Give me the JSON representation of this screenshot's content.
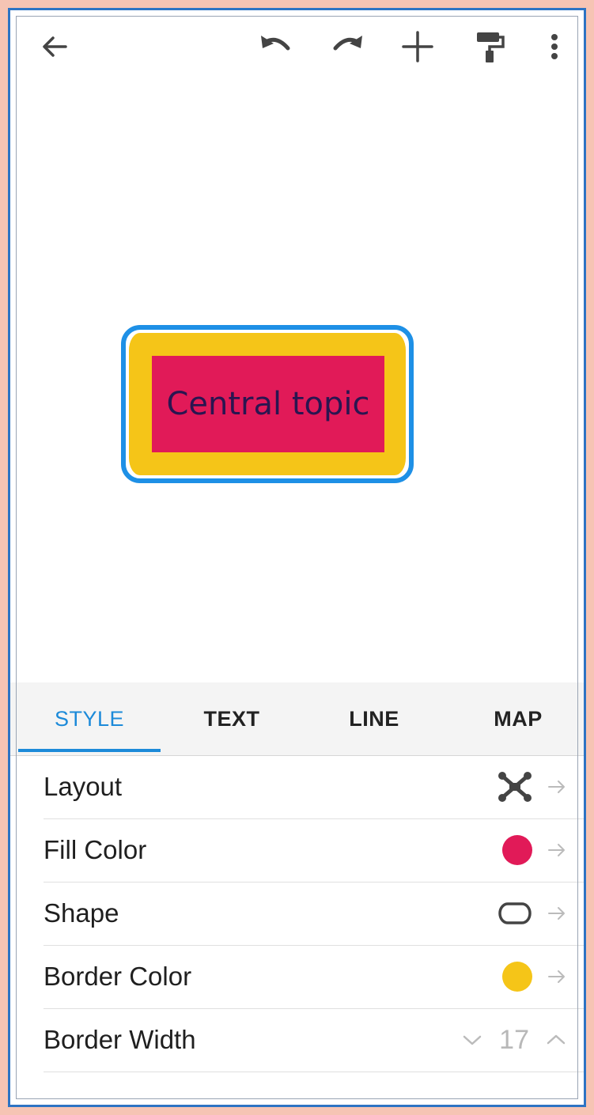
{
  "toolbar": {
    "icons": [
      "back-arrow-icon",
      "undo-icon",
      "redo-icon",
      "plus-icon",
      "paint-roller-icon",
      "more-vert-icon"
    ]
  },
  "canvas": {
    "central_topic": "Central topic"
  },
  "tabs": [
    {
      "label": "STYLE",
      "active": true
    },
    {
      "label": "TEXT",
      "active": false
    },
    {
      "label": "LINE",
      "active": false
    },
    {
      "label": "MAP",
      "active": false
    }
  ],
  "properties": {
    "layout": {
      "label": "Layout",
      "icon": "layout-icon"
    },
    "fill_color": {
      "label": "Fill Color",
      "color": "#e11a58"
    },
    "shape": {
      "label": "Shape",
      "icon": "rounded-shape-icon"
    },
    "border_color": {
      "label": "Border Color",
      "color": "#f5c518"
    },
    "border_width": {
      "label": "Border Width",
      "value": "17"
    }
  },
  "colors": {
    "accent": "#1c8ad9",
    "topic_fill": "#e11a58",
    "topic_border": "#f5c518",
    "selection": "#1e90e6"
  }
}
